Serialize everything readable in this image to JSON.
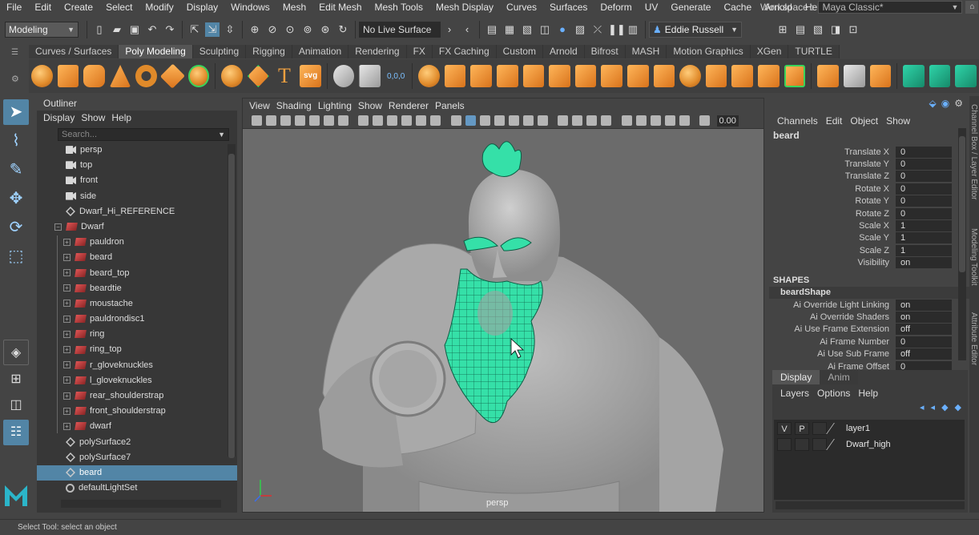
{
  "menubar": {
    "items": [
      "File",
      "Edit",
      "Create",
      "Select",
      "Modify",
      "Display",
      "Windows",
      "Mesh",
      "Edit Mesh",
      "Mesh Tools",
      "Mesh Display",
      "Curves",
      "Surfaces",
      "Deform",
      "UV",
      "Generate",
      "Cache",
      "Arnold",
      "Help"
    ],
    "workspace_label": "Workspace :",
    "workspace_value": "Maya Classic*"
  },
  "statusline": {
    "menu_set": "Modeling",
    "live_surface": "No Live Surface",
    "user": "Eddie Russell"
  },
  "shelf": {
    "tabs": [
      "Curves / Surfaces",
      "Poly Modeling",
      "Sculpting",
      "Rigging",
      "Animation",
      "Rendering",
      "FX",
      "FX Caching",
      "Custom",
      "Arnold",
      "Bifrost",
      "MASH",
      "Motion Graphics",
      "XGen",
      "TURTLE"
    ],
    "active_tab": "Poly Modeling",
    "text_tool": "T",
    "svg_tool": "svg",
    "coord_readout": "0,0,0"
  },
  "outliner": {
    "title": "Outliner",
    "menus": [
      "Display",
      "Show",
      "Help"
    ],
    "search_placeholder": "Search...",
    "items": [
      {
        "label": "persp",
        "icon": "camera-icon",
        "indent": 0,
        "expander": false
      },
      {
        "label": "top",
        "icon": "camera-icon",
        "indent": 0,
        "expander": false
      },
      {
        "label": "front",
        "icon": "camera-icon",
        "indent": 0,
        "expander": false
      },
      {
        "label": "side",
        "icon": "camera-icon",
        "indent": 0,
        "expander": false
      },
      {
        "label": "Dwarf_Hi_REFERENCE",
        "icon": "poly-icon",
        "indent": 0,
        "expander": false
      },
      {
        "label": "Dwarf",
        "icon": "mesh-icon",
        "indent": 0,
        "expander": "minus"
      },
      {
        "label": "pauldron",
        "icon": "mesh-icon",
        "indent": 1,
        "expander": "plus"
      },
      {
        "label": "beard",
        "icon": "mesh-icon",
        "indent": 1,
        "expander": "plus"
      },
      {
        "label": "beard_top",
        "icon": "mesh-icon",
        "indent": 1,
        "expander": "plus"
      },
      {
        "label": "beardtie",
        "icon": "mesh-icon",
        "indent": 1,
        "expander": "plus"
      },
      {
        "label": "moustache",
        "icon": "mesh-icon",
        "indent": 1,
        "expander": "plus"
      },
      {
        "label": "pauldrondisc1",
        "icon": "mesh-icon",
        "indent": 1,
        "expander": "plus"
      },
      {
        "label": "ring",
        "icon": "mesh-icon",
        "indent": 1,
        "expander": "plus"
      },
      {
        "label": "ring_top",
        "icon": "mesh-icon",
        "indent": 1,
        "expander": "plus"
      },
      {
        "label": "r_gloveknuckles",
        "icon": "mesh-icon",
        "indent": 1,
        "expander": "plus"
      },
      {
        "label": "l_gloveknuckles",
        "icon": "mesh-icon",
        "indent": 1,
        "expander": "plus"
      },
      {
        "label": "rear_shoulderstrap",
        "icon": "mesh-icon",
        "indent": 1,
        "expander": "plus"
      },
      {
        "label": "front_shoulderstrap",
        "icon": "mesh-icon",
        "indent": 1,
        "expander": "plus"
      },
      {
        "label": "dwarf",
        "icon": "mesh-icon",
        "indent": 1,
        "expander": "plus"
      },
      {
        "label": "polySurface2",
        "icon": "poly-icon",
        "indent": 0,
        "expander": false
      },
      {
        "label": "polySurface7",
        "icon": "poly-icon",
        "indent": 0,
        "expander": false
      },
      {
        "label": "beard",
        "icon": "poly-icon",
        "indent": 0,
        "expander": false,
        "selected": true
      },
      {
        "label": "defaultLightSet",
        "icon": "set-icon",
        "indent": 0,
        "expander": false
      }
    ]
  },
  "viewport": {
    "menus": [
      "View",
      "Shading",
      "Lighting",
      "Show",
      "Renderer",
      "Panels"
    ],
    "field_value": "0.00",
    "camera_label": "persp",
    "highlight_color": "#35e0a8"
  },
  "channel_box": {
    "menus": [
      "Channels",
      "Edit",
      "Object",
      "Show"
    ],
    "object_name": "beard",
    "transform_attrs": [
      {
        "name": "Translate X",
        "value": "0"
      },
      {
        "name": "Translate Y",
        "value": "0"
      },
      {
        "name": "Translate Z",
        "value": "0"
      },
      {
        "name": "Rotate X",
        "value": "0"
      },
      {
        "name": "Rotate Y",
        "value": "0"
      },
      {
        "name": "Rotate Z",
        "value": "0"
      },
      {
        "name": "Scale X",
        "value": "1"
      },
      {
        "name": "Scale Y",
        "value": "1"
      },
      {
        "name": "Scale Z",
        "value": "1"
      },
      {
        "name": "Visibility",
        "value": "on"
      }
    ],
    "shapes_header": "SHAPES",
    "shape_name": "beardShape",
    "shape_attrs": [
      {
        "name": "Ai Override Light Linking",
        "value": "on"
      },
      {
        "name": "Ai Override Shaders",
        "value": "on"
      },
      {
        "name": "Ai Use Frame Extension",
        "value": "off"
      },
      {
        "name": "Ai Frame Number",
        "value": "0"
      },
      {
        "name": "Ai Use Sub Frame",
        "value": "off"
      },
      {
        "name": "Ai Frame Offset",
        "value": "0"
      }
    ]
  },
  "side_tabs": [
    "Channel Box / Layer Editor",
    "Modeling Toolkit",
    "Attribute Editor"
  ],
  "layer_editor": {
    "tabs": [
      "Display",
      "Anim"
    ],
    "active_tab": "Display",
    "menus": [
      "Layers",
      "Options",
      "Help"
    ],
    "layers": [
      {
        "v": "V",
        "p": "P",
        "name": "layer1"
      },
      {
        "v": "",
        "p": "",
        "name": "Dwarf_high"
      }
    ]
  },
  "help_line": "Select Tool: select an object"
}
